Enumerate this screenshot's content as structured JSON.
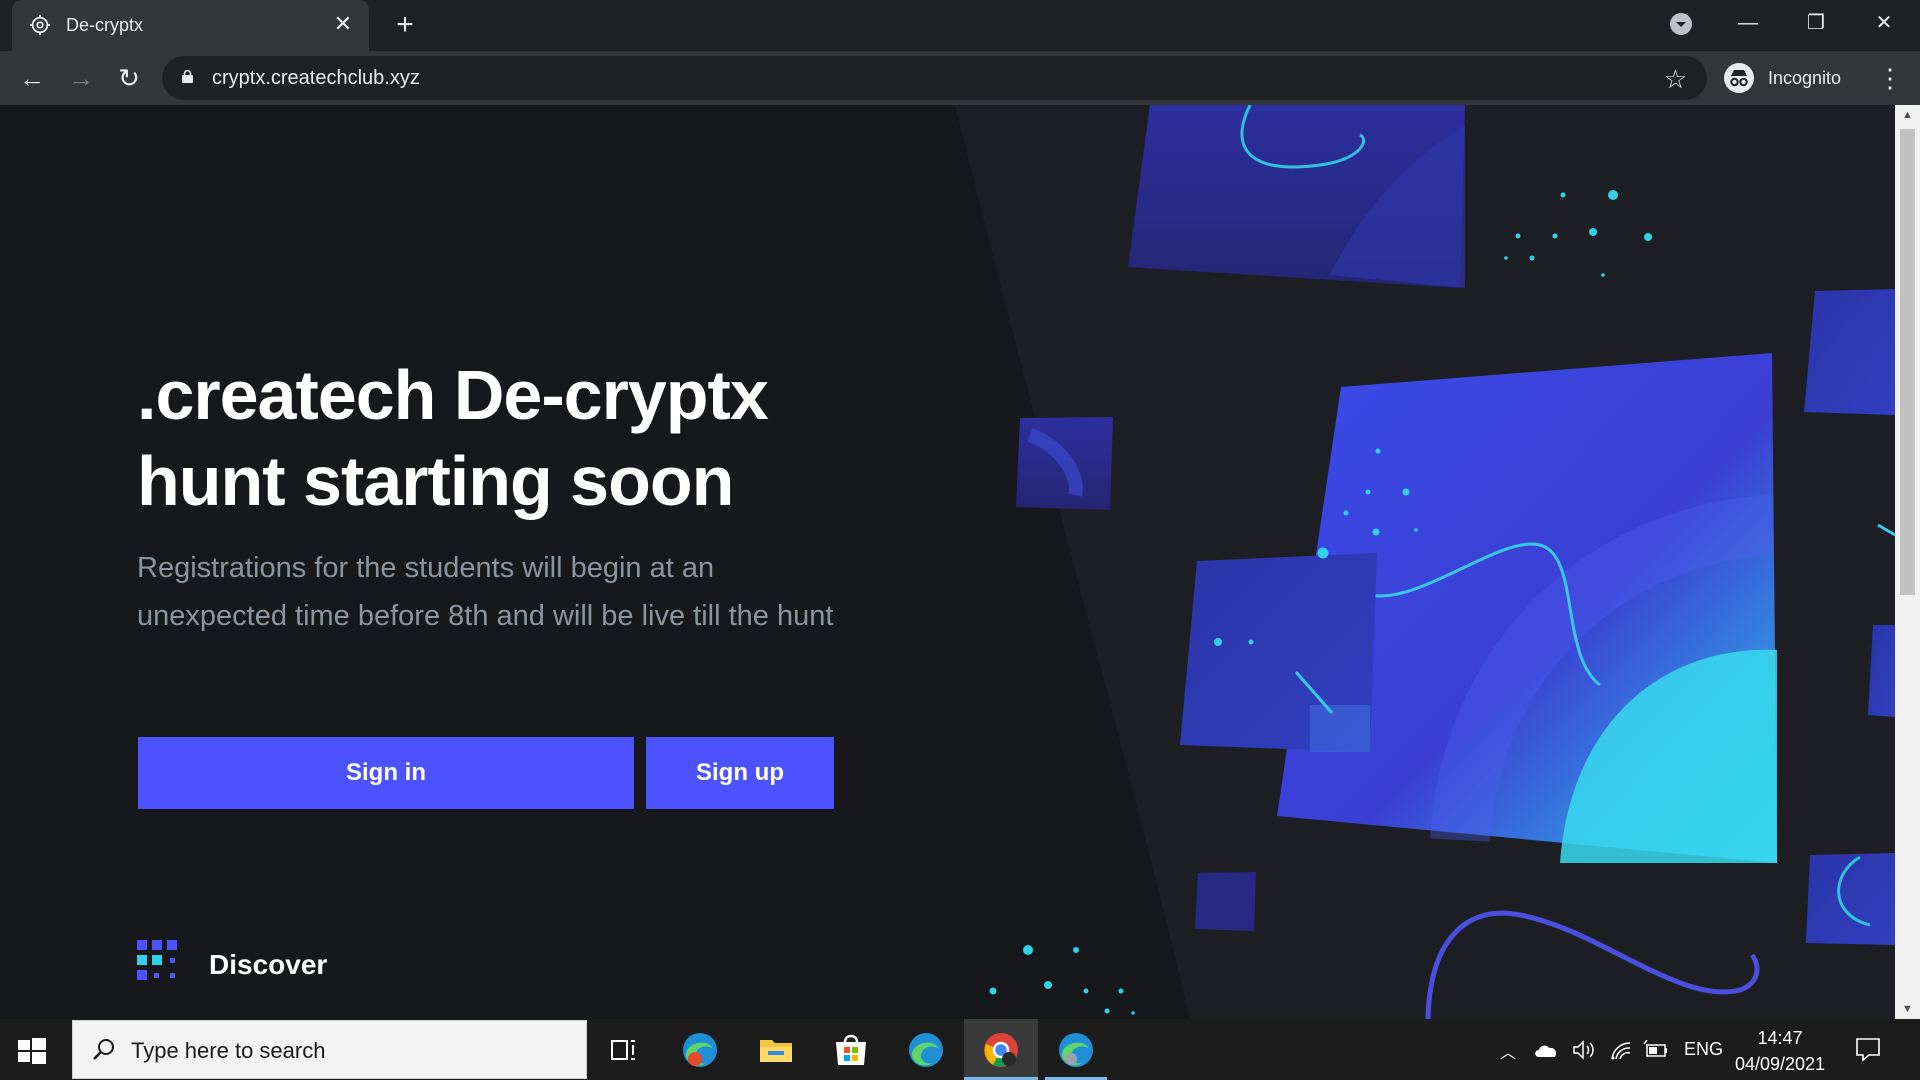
{
  "browser": {
    "tab_title": "De-cryptx",
    "url": "cryptx.createchclub.xyz",
    "profile_label": "Incognito"
  },
  "hero": {
    "title_line1": ".createch De-cryptx",
    "title_line2": "hunt starting soon",
    "subtitle": "Registrations for the students will begin at an unexpected time before 8th and will be live till the hunt",
    "sign_in_label": "Sign in",
    "sign_up_label": "Sign up",
    "discover_label": "Discover"
  },
  "colors": {
    "accent": "#4c52ff",
    "page_background": "#16181c",
    "subtitle_text": "#8b94a3",
    "art_blue": "#3a3fd9",
    "art_cyan": "#2fe4f2"
  },
  "taskbar": {
    "search_placeholder": "Type here to search",
    "language": "ENG",
    "time": "14:47",
    "date": "04/09/2021",
    "pinned_icons": [
      "task-view-icon",
      "edge-canary-icon",
      "file-explorer-icon",
      "microsoft-store-icon",
      "edge-icon",
      "chrome-icon",
      "edge-profile-icon"
    ]
  }
}
